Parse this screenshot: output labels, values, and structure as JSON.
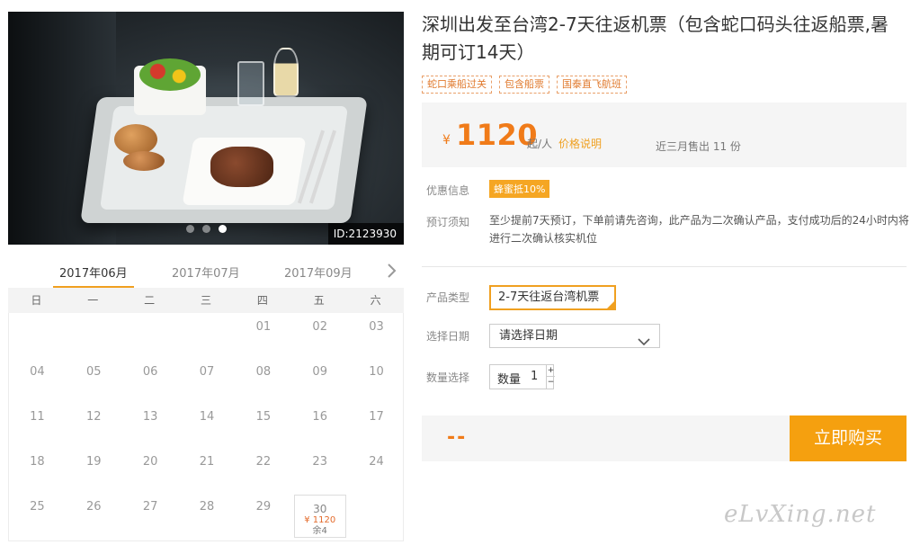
{
  "hero": {
    "image_id": "ID:2123930",
    "dots": [
      false,
      false,
      true
    ]
  },
  "calendar": {
    "months": [
      "2017年06月",
      "2017年07月",
      "2017年09月"
    ],
    "active_month_index": 0,
    "weekdays": [
      "日",
      "一",
      "二",
      "三",
      "四",
      "五",
      "六"
    ],
    "rows": [
      [
        "",
        "",
        "",
        "",
        "01",
        "02",
        "03"
      ],
      [
        "04",
        "05",
        "06",
        "07",
        "08",
        "09",
        "10"
      ],
      [
        "11",
        "12",
        "13",
        "14",
        "15",
        "16",
        "17"
      ],
      [
        "18",
        "19",
        "20",
        "21",
        "22",
        "23",
        "24"
      ],
      [
        "25",
        "26",
        "27",
        "28",
        "29",
        "30",
        ""
      ]
    ],
    "available_day": {
      "day": "30",
      "price": "¥ 1120",
      "remaining": "余4"
    }
  },
  "product": {
    "title": "深圳出发至台湾2-7天往返机票（包含蛇口码头往返船票,暑期可订14天）",
    "tags": [
      "蛇口乘船过关",
      "包含船票",
      "国泰直飞航班"
    ],
    "price": {
      "currency": "¥",
      "amount": "1120",
      "unit": "起/人",
      "explain_link": "价格说明",
      "sold": "近三月售出 11 份"
    },
    "promo_label": "优惠信息",
    "promo_badge": "蜂蜜抵10%",
    "notice_label": "预订须知",
    "notice_text": "至少提前7天预订，下单前请先咨询，此产品为二次确认产品，支付成功后的24小时内将进行二次确认核实机位",
    "type_label": "产品类型",
    "type_value": "2-7天往返台湾机票",
    "date_label": "选择日期",
    "date_placeholder": "请选择日期",
    "qty_label": "数量选择",
    "qty_inner_label": "数量",
    "qty_value": "1",
    "qty_plus": "+",
    "qty_minus": "−",
    "total_placeholder": "--",
    "buy_button": "立即购买"
  },
  "watermark": "eLvXing.net",
  "colors": {
    "accent": "#f5a00f",
    "price": "#f07b19",
    "tag_border": "#e9a06a"
  }
}
